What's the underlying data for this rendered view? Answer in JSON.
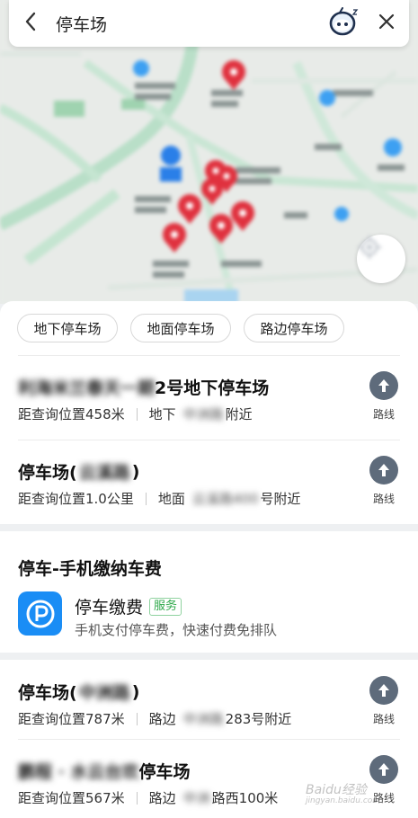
{
  "search": {
    "query": "停车场",
    "back_icon": "chevron-left-icon",
    "assistant_icon": "robot-assistant-icon",
    "close_icon": "close-icon"
  },
  "map": {
    "locate_icon": "locate-icon",
    "marker_color": "#e0313e"
  },
  "filters": [
    "地下停车场",
    "地面停车场",
    "路边停车场"
  ],
  "results_a": [
    {
      "title_blur": "利海米兰春天一期",
      "title": "2号地下停车场",
      "distance": "距查询位置458米",
      "type": "地下",
      "addr_blur": "中洲路",
      "addr_suffix": "附近",
      "route_label": "路线"
    },
    {
      "title": "停车场(",
      "title_blur": "云溪路",
      "title_end": ")",
      "distance": "距查询位置1.0公里",
      "type": "地面",
      "addr_blur": "云溪路400",
      "addr_suffix": "号附近",
      "route_label": "路线"
    }
  ],
  "service": {
    "section_title": "停车-手机缴纳车费",
    "name": "停车缴费",
    "badge": "服务",
    "desc": "手机支付停车费，快速付费免排队",
    "icon": "parking-p-icon",
    "accent": "#1a8df5"
  },
  "results_b": [
    {
      "title": "停车场(",
      "title_blur": "中洲路",
      "title_end": ")",
      "distance": "距查询位置787米",
      "type": "路边",
      "addr_blur": "中洲路",
      "addr_suffix": "283号附近",
      "route_label": "路线"
    },
    {
      "title_blur": "鹏程 · 水云台欢",
      "title": "停车场",
      "distance": "距查询位置567米",
      "type": "路边",
      "addr_blur": "中洲",
      "addr_suffix": "路西100米",
      "route_label": "路线"
    }
  ],
  "watermark": {
    "text": "Baidu经验",
    "sub": "jingyan.baidu.com"
  }
}
